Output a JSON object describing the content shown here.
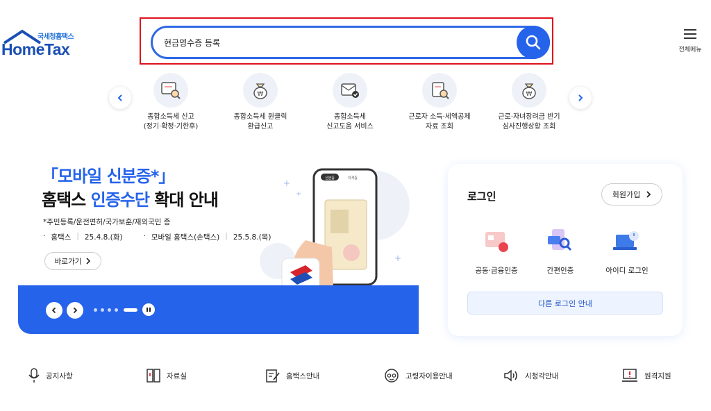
{
  "logo": {
    "sub": "국세청홈택스",
    "main": "HomeTax"
  },
  "search": {
    "value": "현금영수증 등록"
  },
  "menu": {
    "label": "전체메뉴"
  },
  "services": [
    {
      "line1": "종합소득세 신고",
      "line2": "(정기·확정·기한후)",
      "icon": "tax-document-search-icon"
    },
    {
      "line1": "종합소득세 원클릭",
      "line2": "환급신고",
      "icon": "money-bag-icon"
    },
    {
      "line1": "종합소득세",
      "line2": "신고도움 서비스",
      "icon": "tax-mail-check-icon"
    },
    {
      "line1": "근로자 소득·세액공제",
      "line2": "자료 조회",
      "icon": "clipboard-search-icon"
    },
    {
      "line1": "근로·자녀장려금 반기",
      "line2": "심사진행상황 조회",
      "icon": "money-bag-icon"
    }
  ],
  "banner": {
    "title1": "「모바일 신분증*」",
    "title2_a": "홈택스 ",
    "title2_hl": "인증수단",
    "title2_b": " 확대 안내",
    "note": "*주민등록/운전면허/국가보훈/재외국민 증",
    "date1_label": "홈택스",
    "date1": "25.4.8.(화)",
    "date2_label": "모바일 홈택스(손택스)",
    "date2": "25.5.8.(목)",
    "go": "바로가기",
    "phone_tab1": "신분증",
    "phone_tab2": "자격증"
  },
  "login": {
    "title": "로그인",
    "join": "회원가입",
    "options": [
      "공동·금융인증",
      "간편인증",
      "아이디 로그인"
    ],
    "other": "다른 로그인 안내"
  },
  "quicklinks": [
    {
      "label": "공지사항",
      "icon": "microphone-icon"
    },
    {
      "label": "자료실",
      "icon": "folder-icon"
    },
    {
      "label": "홈택스안내",
      "icon": "note-pen-icon"
    },
    {
      "label": "고령자이용안내",
      "icon": "elder-face-icon"
    },
    {
      "label": "시청각안내",
      "icon": "speaker-icon"
    },
    {
      "label": "원격지원",
      "icon": "remote-monitor-icon"
    }
  ],
  "colors": {
    "brand": "#2563eb",
    "highlight_frame": "#e0101c"
  }
}
